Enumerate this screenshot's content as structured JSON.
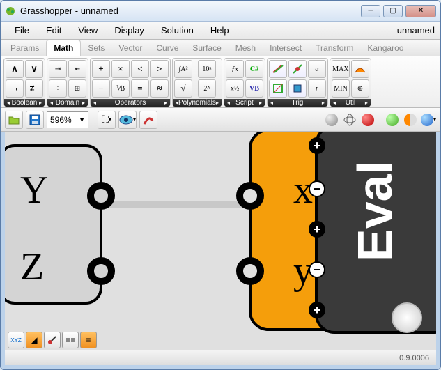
{
  "title": "Grasshopper - unnamed",
  "doc_name": "unnamed",
  "menus": [
    "File",
    "Edit",
    "View",
    "Display",
    "Solution",
    "Help"
  ],
  "tabs": [
    "Params",
    "Math",
    "Sets",
    "Vector",
    "Curve",
    "Surface",
    "Mesh",
    "Intersect",
    "Transform",
    "Kangaroo"
  ],
  "active_tab": "Math",
  "ribbon_groups": [
    {
      "label": "Boolean",
      "icons": [
        "∧",
        "∨",
        "¬",
        "≢"
      ]
    },
    {
      "label": "Domain",
      "icons": [
        "⇥",
        "⇤",
        "÷",
        "⊞"
      ]
    },
    {
      "label": "Operators",
      "icons": [
        "+",
        "×",
        "<",
        ">",
        "−",
        "⅟B",
        "=",
        "≈"
      ]
    },
    {
      "label": "Polynomials",
      "icons": [
        "∫A²",
        "10ⁿ",
        "√",
        "2ᴬ"
      ]
    },
    {
      "label": "Script",
      "icons": [
        "ƒx",
        "C#",
        "x½",
        "VB"
      ]
    },
    {
      "label": "Trig",
      "icons": [
        "↗",
        "↘",
        "α",
        "⬈",
        "⬊",
        "r"
      ]
    },
    {
      "label": "Util",
      "icons": [
        "MAX",
        "▲",
        "MIN",
        "⊕"
      ]
    }
  ],
  "zoom": "596%",
  "version": "0.9.0006",
  "canvas": {
    "labels_left": [
      "Y",
      "Z"
    ],
    "labels_right": [
      "x",
      "y"
    ],
    "inner_text": "Eval"
  },
  "toolbar": {
    "open": "open-icon",
    "save": "save-icon",
    "target": "target-icon",
    "eye": "eye-icon",
    "sketch": "sketch-icon"
  }
}
